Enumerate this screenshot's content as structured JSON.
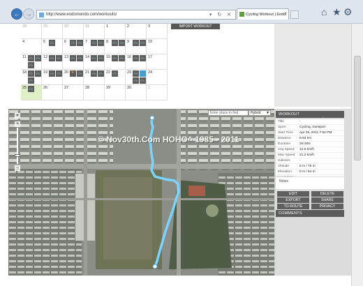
{
  "browser": {
    "url": "http://www.endomondo.com/workouts/",
    "tab_title": "Cycling Workout | Endomo...",
    "tab_close": "×",
    "address_icons": "▾ ↻ ✕"
  },
  "calendar": {
    "cells": [
      {
        "label": "28",
        "dim": true,
        "icons": []
      },
      {
        "label": "29",
        "dim": true,
        "icons": []
      },
      {
        "label": "30",
        "dim": true,
        "icons": []
      },
      {
        "label": "31",
        "dim": true,
        "icons": []
      },
      {
        "label": "1",
        "dim": false,
        "icons": []
      },
      {
        "label": "2",
        "dim": false,
        "icons": []
      },
      {
        "label": "3",
        "dim": false,
        "icons": []
      },
      {
        "label": "4",
        "dim": false,
        "icons": []
      },
      {
        "label": "5",
        "dim": false,
        "icons": [
          "bike"
        ]
      },
      {
        "label": "6",
        "dim": false,
        "icons": [
          "bike",
          "bike"
        ]
      },
      {
        "label": "7",
        "dim": false,
        "icons": [
          "bike",
          "bike"
        ]
      },
      {
        "label": "8",
        "dim": false,
        "icons": [
          "bike",
          "bike"
        ]
      },
      {
        "label": "9",
        "dim": false,
        "icons": [
          "bike",
          "bike"
        ]
      },
      {
        "label": "10",
        "dim": false,
        "icons": []
      },
      {
        "label": "11",
        "dim": false,
        "icons": [
          "bike",
          "bike",
          "bike",
          "bike"
        ]
      },
      {
        "label": "12",
        "dim": false,
        "icons": [
          "bike",
          "bike"
        ]
      },
      {
        "label": "13",
        "dim": false,
        "icons": [
          "bike",
          "bike"
        ]
      },
      {
        "label": "14",
        "dim": false,
        "icons": [
          "bike",
          "bike"
        ]
      },
      {
        "label": "15",
        "dim": false,
        "icons": [
          "bike",
          "bike"
        ]
      },
      {
        "label": "16",
        "dim": false,
        "icons": [
          "bike",
          "bike"
        ]
      },
      {
        "label": "17",
        "dim": false,
        "icons": []
      },
      {
        "label": "18",
        "dim": false,
        "icons": [
          "bike",
          "bike",
          "bike",
          "bike"
        ]
      },
      {
        "label": "19",
        "dim": false,
        "icons": [
          "bike",
          "bike"
        ]
      },
      {
        "label": "20",
        "dim": false,
        "icons": [
          "run",
          "bike"
        ]
      },
      {
        "label": "21",
        "dim": false,
        "icons": [
          "bike",
          "bike"
        ]
      },
      {
        "label": "22",
        "dim": false,
        "icons": [
          "bike"
        ]
      },
      {
        "label": "23",
        "dim": false,
        "icons": [
          "bike",
          "blue",
          "bike",
          "bike",
          "bike"
        ]
      },
      {
        "label": "24",
        "dim": false,
        "icons": []
      },
      {
        "label": "25",
        "dim": false,
        "today": true,
        "icons": [
          "bike"
        ]
      },
      {
        "label": "26",
        "dim": false,
        "icons": []
      },
      {
        "label": "27",
        "dim": false,
        "icons": []
      },
      {
        "label": "28",
        "dim": false,
        "icons": []
      },
      {
        "label": "29",
        "dim": false,
        "icons": []
      },
      {
        "label": "30",
        "dim": false,
        "icons": []
      },
      {
        "label": "1",
        "dim": true,
        "icons": []
      }
    ]
  },
  "page": {
    "import_button": "IMPORT WORKOUT"
  },
  "map": {
    "search_placeholder": "Enter place to find",
    "map_type": "Hybrid",
    "watermark": "© Nov30th.Com HOHO^ 1985 - 2011",
    "zoom_plus": "+",
    "zoom_minus": "−"
  },
  "workout": {
    "header": "WORKOUT",
    "caret": "▲",
    "fields": [
      {
        "label": "Title",
        "value": "-"
      },
      {
        "label": "Sport",
        "value": "Cycling, transport"
      },
      {
        "label": "Start Time",
        "value": "Apr 25, 2011 7:52 PM"
      },
      {
        "label": "Distance",
        "value": "0.63 km"
      },
      {
        "label": "Duration",
        "value": "3m:00s"
      },
      {
        "label": "Avg Speed",
        "value": "12.6 km/h"
      },
      {
        "label": "Max Speed",
        "value": "21.2 km/h"
      },
      {
        "label": "Calories",
        "value": "-"
      },
      {
        "label": "Altitude",
        "value": "8 m / 76 m"
      },
      {
        "label": "Elevation",
        "value": "0 m / 54 m"
      },
      {
        "label": "Heart Rate",
        "value": "-"
      }
    ],
    "notes_label": "Notes",
    "actions": {
      "edit": "EDIT",
      "delete": "DELETE",
      "export": "EXPORT",
      "share": "SHARE",
      "route": "TO ROUTE",
      "privacy": "PRIVACY"
    },
    "comments": "COMMENTS"
  },
  "colors": {
    "route": "#7bd4ff",
    "panel_dark": "#5b5b5b",
    "accent_blue": "#3d79c0"
  }
}
